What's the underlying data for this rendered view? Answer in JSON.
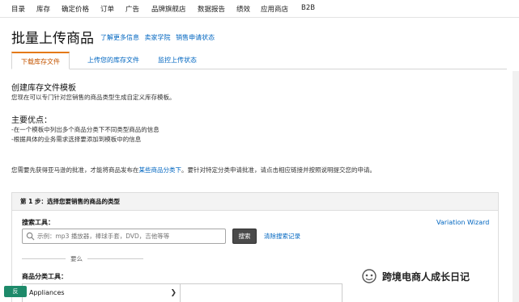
{
  "topnav": {
    "items": [
      "目录",
      "库存",
      "确定价格",
      "订单",
      "广告",
      "品牌旗舰店",
      "数据报告",
      "绩效",
      "应用商店",
      "B2B"
    ]
  },
  "page": {
    "title": "批量上传商品",
    "links": [
      "了解更多信息",
      "卖家学院",
      "销售申请状态"
    ]
  },
  "tabs": [
    "下载库存文件",
    "上传您的库存文件",
    "监控上传状态"
  ],
  "active_tab": 0,
  "intro": {
    "heading": "创建库存文件模板",
    "desc": "您现在可以专门针对您销售的商品类型生成自定义库存模板。",
    "adv_heading": "主要优点：",
    "adv_1": "-在一个模板中列出多个商品分类下不同类型商品的信息",
    "adv_2": "-根据具体的业务需求选择要添加到模板中的信息",
    "notice_before": "您需要先获得亚马逊的批准，才能将商品发布在",
    "notice_link": "某些商品分类下",
    "notice_after": "。要针对特定分类申请批准，请点击相应链接并按照说明提交您的申请。"
  },
  "step1": {
    "header": "第 1 步：选择您要销售的商品的类型",
    "search_label": "搜索工具：",
    "search_placeholder": "示例：mp3 播放器，棒球手套，DVD，吉他等等",
    "search_button": "搜索",
    "clear_link": "清除搜索记录",
    "variation_link": "Variation Wizard",
    "or_text": "要么",
    "category_label": "商品分类工具：",
    "category_items": [
      "Appliances"
    ]
  },
  "badge": "反",
  "watermark": "跨境电商人成长日记",
  "colors": {
    "link": "#0066c0",
    "active_tab": "#c45500",
    "tab_accent": "#e47911",
    "search_button_bg": "#4a4a4a",
    "badge_bg": "#1e8a6a"
  }
}
